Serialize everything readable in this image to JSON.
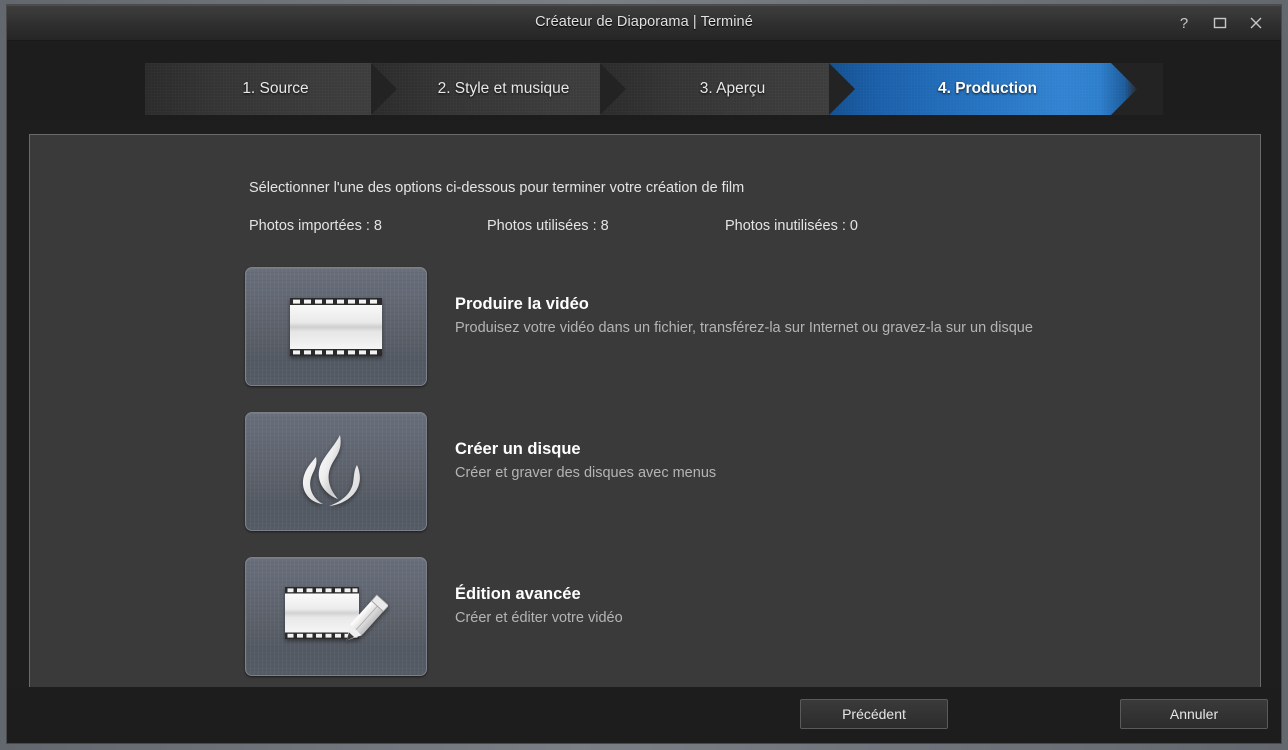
{
  "window": {
    "title": "Créateur de Diaporama | Terminé",
    "controls": [
      {
        "name": "help-button",
        "glyph": "?"
      },
      {
        "name": "maximize-button",
        "glyph": "□"
      },
      {
        "name": "close-button",
        "glyph": "✕"
      }
    ]
  },
  "steps": [
    {
      "label": "1. Source",
      "active": false
    },
    {
      "label": "2. Style et musique",
      "active": false
    },
    {
      "label": "3. Aperçu",
      "active": false
    },
    {
      "label": "4. Production",
      "active": true
    }
  ],
  "main": {
    "intro": "Sélectionner l'une des options ci-dessous pour terminer votre création de film",
    "counts": [
      "Photos importées : 8",
      "Photos utilisées : 8",
      "Photos inutilisées : 0"
    ],
    "options": [
      {
        "icon": "film-strip-icon",
        "title": "Produire la vidéo",
        "desc": "Produisez votre vidéo dans un fichier, transférez-la sur Internet ou gravez-la sur un disque"
      },
      {
        "icon": "flame-icon",
        "title": "Créer un disque",
        "desc": "Créer et graver des disques avec menus"
      },
      {
        "icon": "film-strip-pencil-icon",
        "title": "Édition avancée",
        "desc": "Créer et éditer votre vidéo"
      }
    ]
  },
  "footer": {
    "previous_label": "Précédent",
    "cancel_label": "Annuler"
  },
  "colors": {
    "accent_blue": "#2573c0",
    "panel_bg": "#3a3a3a",
    "window_chrome": "#1d1d1d",
    "thumb_top": "#686e7a",
    "thumb_bottom": "#545a64",
    "text_primary": "#e4e4e4",
    "text_secondary": "#b4b4b4"
  }
}
